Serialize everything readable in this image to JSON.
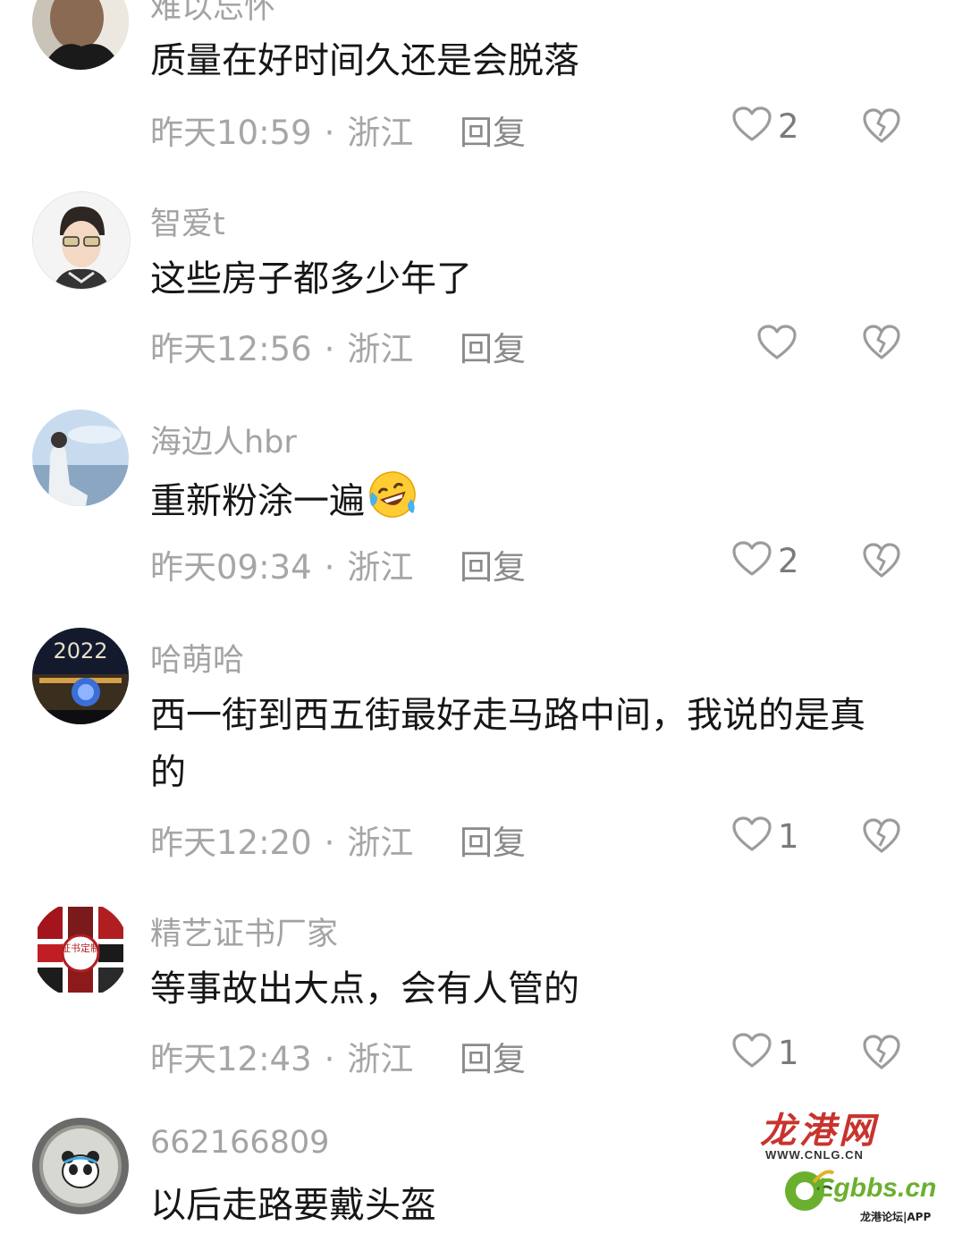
{
  "comments": [
    {
      "username": "难以忘怀",
      "text": "质量在好时间久还是会脱落",
      "time": "昨天10:59",
      "location": "浙江",
      "reply_label": "回复",
      "likes": "2"
    },
    {
      "username": "智爱t",
      "text": "这些房子都多少年了",
      "time": "昨天12:56",
      "location": "浙江",
      "reply_label": "回复",
      "likes": ""
    },
    {
      "username": "海边人hbr",
      "text": "重新粉涂一遍",
      "time": "昨天09:34",
      "location": "浙江",
      "reply_label": "回复",
      "likes": "2"
    },
    {
      "username": "哈萌哈",
      "text": "西一街到西五街最好走马路中间，我说的是真的",
      "time": "昨天12:20",
      "location": "浙江",
      "reply_label": "回复",
      "likes": "1",
      "avatar_text": "2022"
    },
    {
      "username": "精艺证书厂家",
      "text": "等事故出大点，会有人管的",
      "time": "昨天12:43",
      "location": "浙江",
      "reply_label": "回复",
      "likes": "1",
      "avatar_text": "证书定制"
    },
    {
      "username": "662166809",
      "text": "以后走路要戴头盔",
      "time": "",
      "location": "",
      "reply_label": "",
      "likes": ""
    }
  ],
  "separator": "·",
  "watermark": {
    "logo_cn": "龙港网",
    "url": "WWW.CNLG.CN",
    "brand": "Lgbbs.cn",
    "sub": "龙港论坛|APP"
  },
  "colors": {
    "text": "#161616",
    "muted": "#a6a6a6",
    "watermark_red": "#c9332d",
    "watermark_green": "#6ab02e"
  },
  "icons": {
    "like": "heart-outline-icon",
    "dislike": "broken-heart-icon",
    "emoji": "laughing-tears-emoji"
  }
}
